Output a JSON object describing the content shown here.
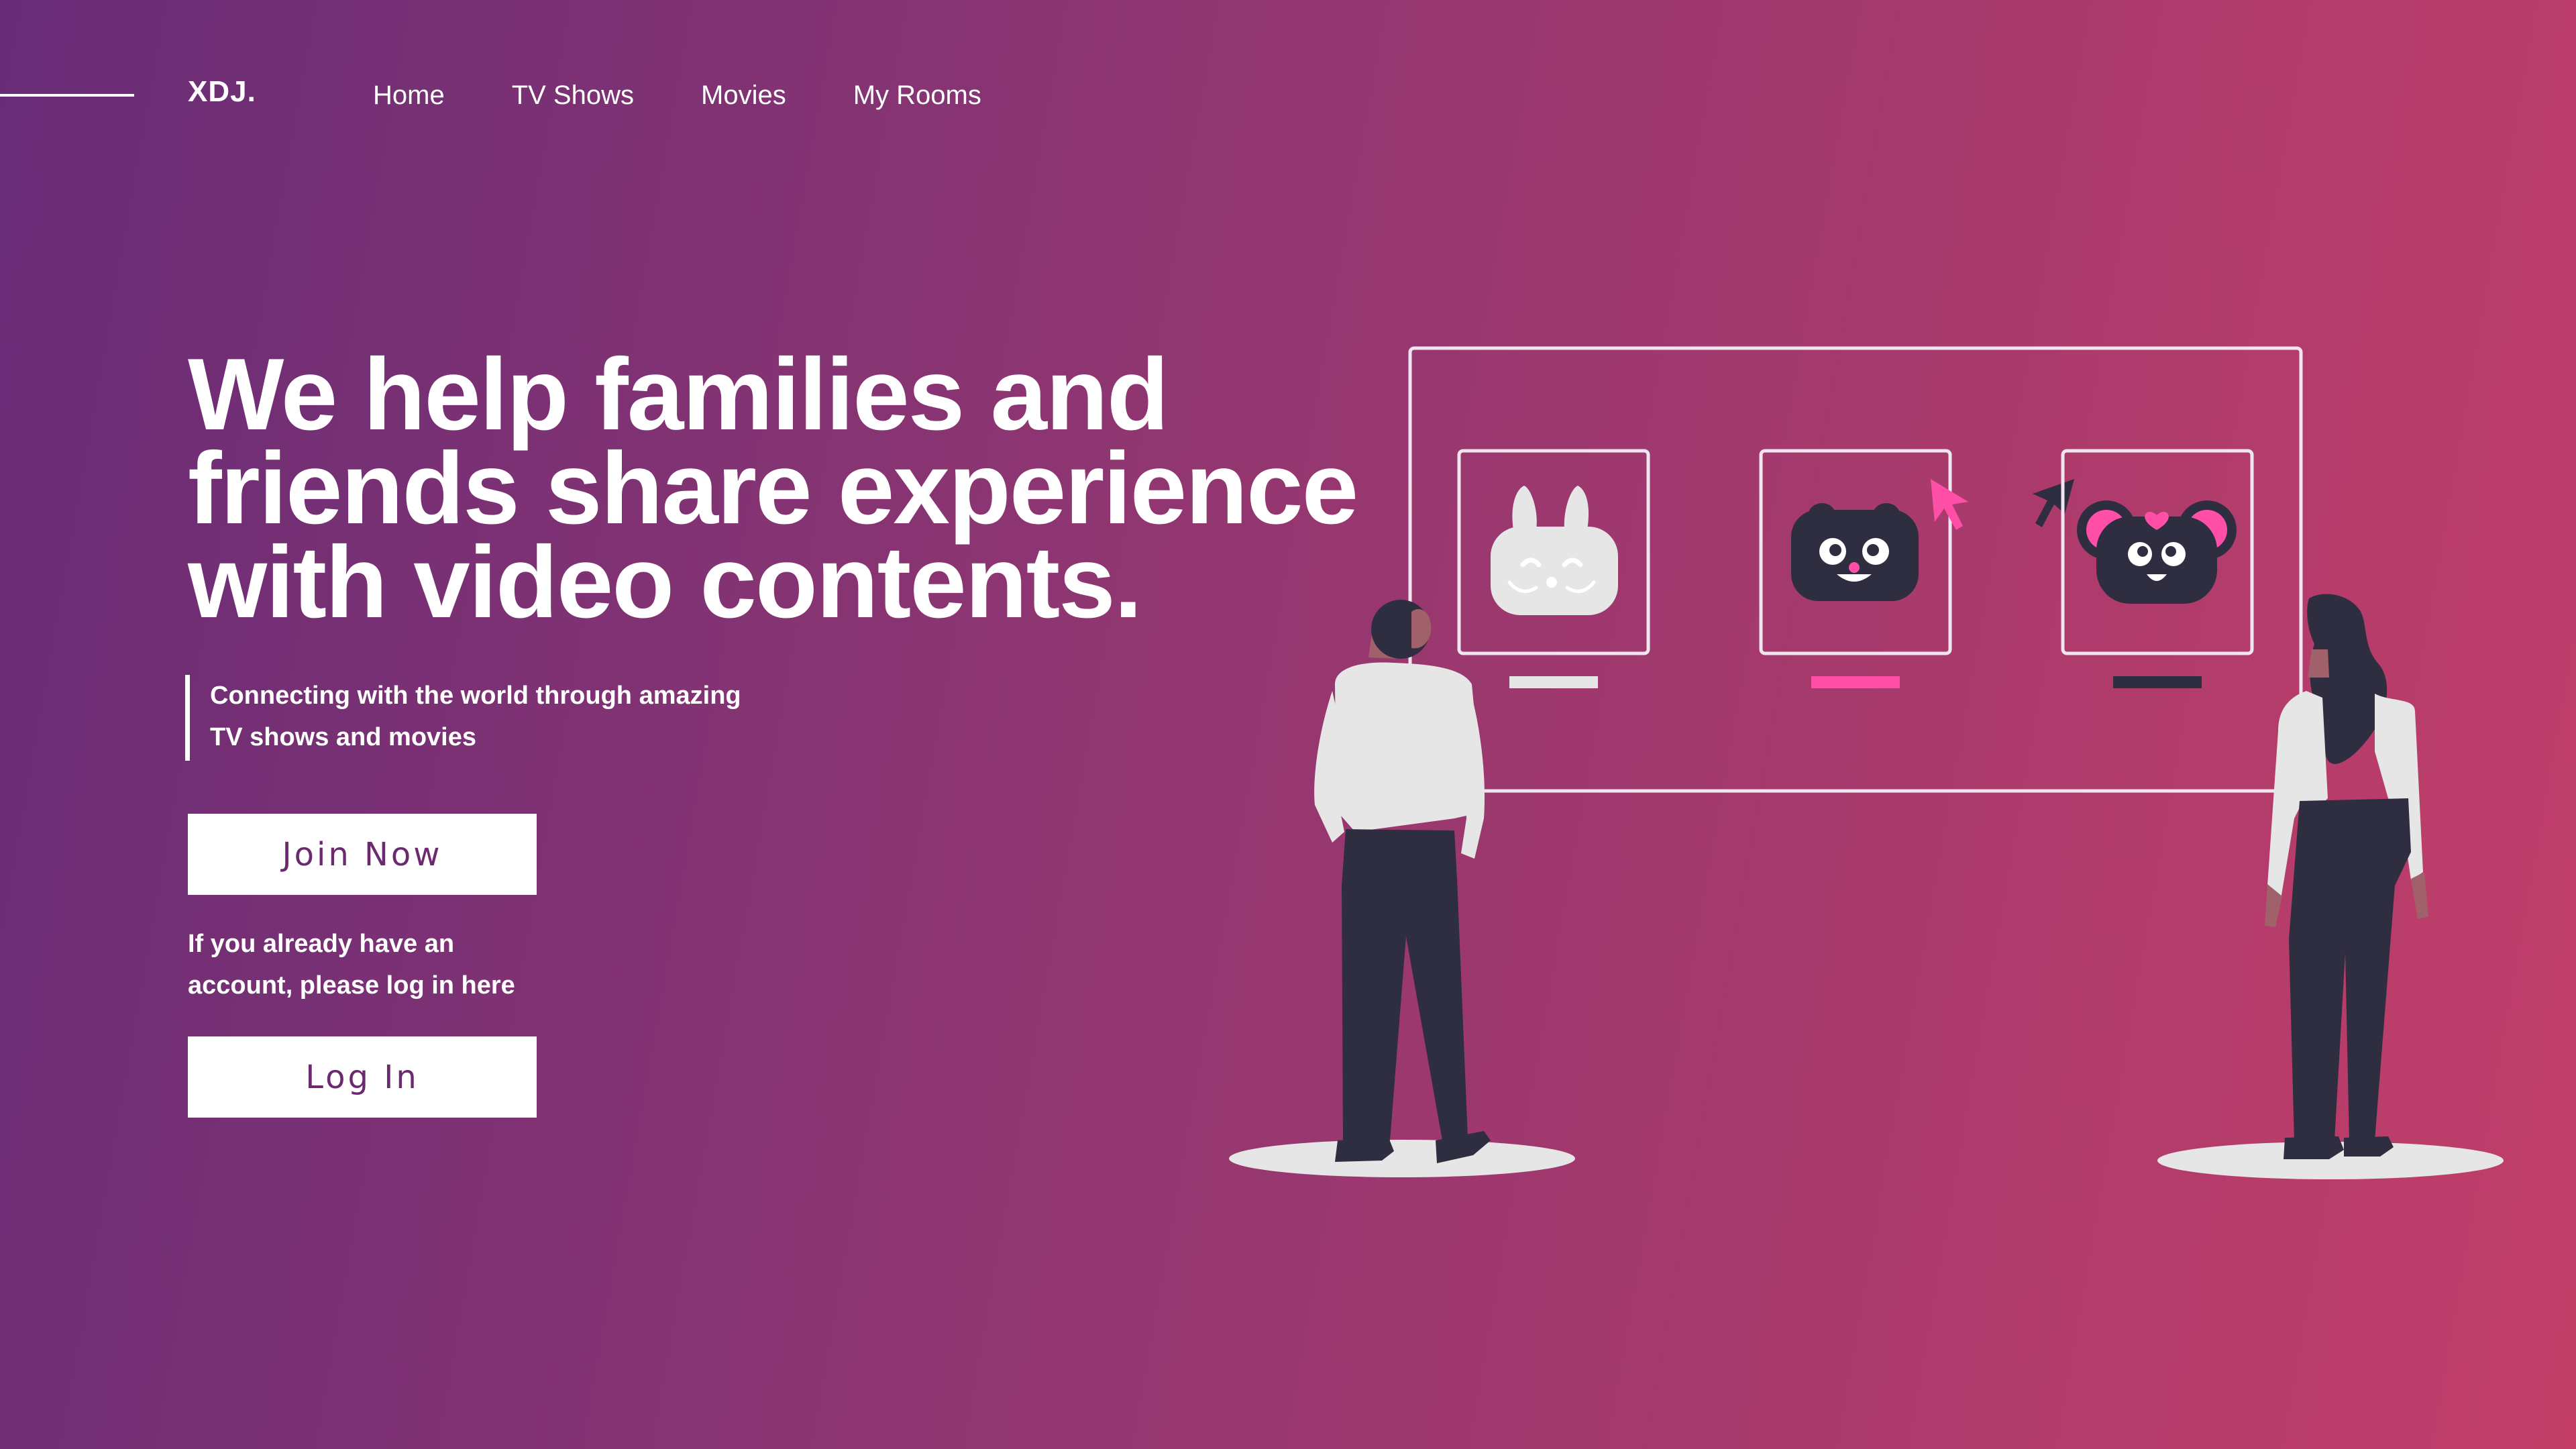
{
  "header": {
    "logo": "XDJ.",
    "nav": [
      "Home",
      "TV Shows",
      "Movies",
      "My Rooms"
    ]
  },
  "hero": {
    "headline_lines": [
      "We help families and",
      "friends share experience",
      "with video contents."
    ],
    "subtitle_lines": [
      "Connecting with the world through amazing",
      "TV shows and movies"
    ],
    "join_button": "Join Now",
    "login_hint_lines": [
      "If you already have an",
      "account, please log in here"
    ],
    "login_button": "Log In"
  },
  "illustration": {
    "avatars": [
      "bunny-avatar",
      "bear-avatar",
      "mouse-avatar"
    ],
    "colors": {
      "frame": "#f0e6ef",
      "figure_dark": "#2f2e41",
      "figure_light": "#e6e6e6",
      "accent_pink": "#ff4fa7",
      "skin": "#a0616a"
    }
  },
  "colors": {
    "background_start": "#682c76",
    "background_end": "#c23e69",
    "button_text": "#6b2a6f"
  }
}
